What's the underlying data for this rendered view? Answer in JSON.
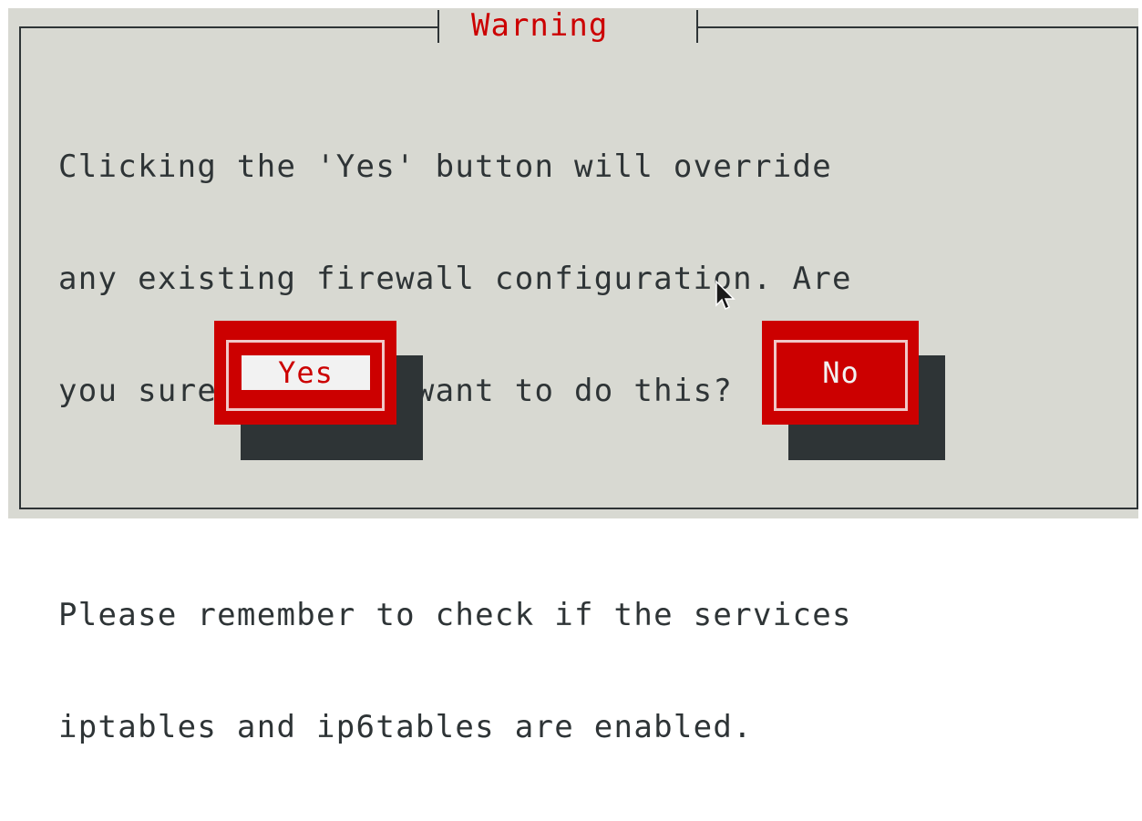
{
  "dialog": {
    "title": "Warning",
    "message_lines": [
      "Clicking the 'Yes' button will override",
      "any existing firewall configuration. Are",
      "you sure that you want to do this?",
      "",
      "Please remember to check if the services",
      "iptables and ip6tables are enabled."
    ],
    "buttons": {
      "yes_label": "Yes",
      "no_label": "No"
    },
    "focused_button": "yes"
  },
  "colors": {
    "background": "#d8d9d2",
    "accent": "#cc0000",
    "text": "#2e3436",
    "shadow": "#2e3436"
  },
  "icons": {
    "cursor": "mouse-pointer-icon"
  }
}
